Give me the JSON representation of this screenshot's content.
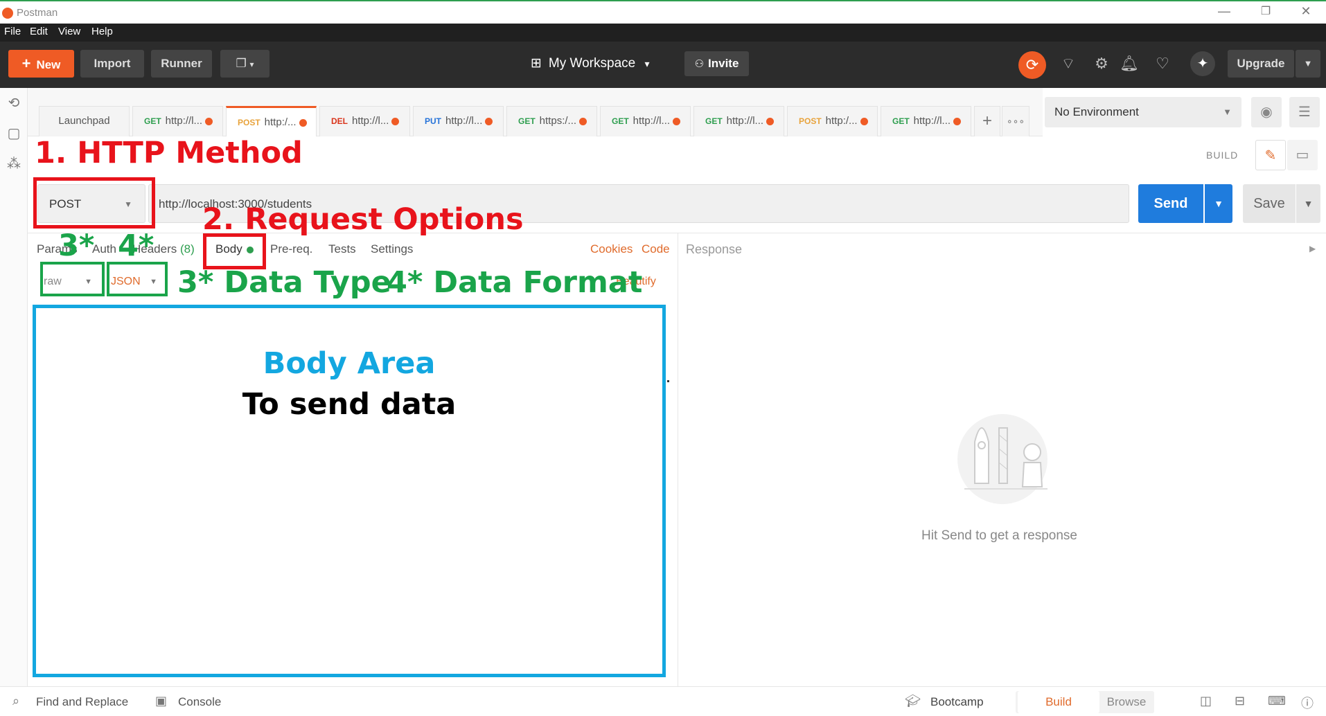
{
  "window": {
    "title": "Postman",
    "min": "—",
    "max": "❐",
    "close": "✕"
  },
  "menu": [
    "File",
    "Edit",
    "View",
    "Help"
  ],
  "header": {
    "new_label": "New",
    "import_label": "Import",
    "runner_label": "Runner",
    "workspace_label": "My Workspace",
    "invite_label": "Invite",
    "upgrade_label": "Upgrade"
  },
  "tabs": [
    {
      "label": "Launchpad",
      "method": "",
      "url": ""
    },
    {
      "label": "",
      "method": "GET",
      "url": "http://l..."
    },
    {
      "label": "",
      "method": "POST",
      "url": "http:/..."
    },
    {
      "label": "",
      "method": "DEL",
      "url": "http://l..."
    },
    {
      "label": "",
      "method": "PUT",
      "url": "http://l..."
    },
    {
      "label": "",
      "method": "GET",
      "url": "https:/..."
    },
    {
      "label": "",
      "method": "GET",
      "url": "http://l..."
    },
    {
      "label": "",
      "method": "GET",
      "url": "http://l..."
    },
    {
      "label": "",
      "method": "POST",
      "url": "http:/..."
    },
    {
      "label": "",
      "method": "GET",
      "url": "http://l..."
    }
  ],
  "environment": {
    "selected": "No Environment"
  },
  "mode_label": "BUILD",
  "request": {
    "method": "POST",
    "url": "http://localhost:3000/students",
    "send_label": "Send",
    "save_label": "Save"
  },
  "request_tabs": {
    "params": "Params",
    "auth": "Auth",
    "headers": "Headers",
    "headers_count": "(8)",
    "body": "Body",
    "prereq": "Pre-req.",
    "tests": "Tests",
    "settings": "Settings",
    "cookies": "Cookies",
    "code": "Code"
  },
  "body_options": {
    "data_type": "raw",
    "data_format": "JSON",
    "beautify": "Beautify"
  },
  "response": {
    "label": "Response",
    "empty_message": "Hit Send to get a response"
  },
  "annotations": {
    "http_method": "1. HTTP Method",
    "request_options": "2. Request Options",
    "marker3": "3*",
    "marker4": "4*",
    "data_type": "3* Data Type",
    "data_format": "4* Data Format",
    "body_area_title": "Body Area",
    "body_area_sub": "To send data"
  },
  "footer": {
    "find_replace": "Find and Replace",
    "console": "Console",
    "bootcamp": "Bootcamp",
    "build": "Build",
    "browse": "Browse"
  },
  "colors": {
    "accent": "#ef5b25",
    "send_blue": "#1f7cdd",
    "annotation_red": "#e8131b",
    "annotation_green": "#1aa44a",
    "annotation_blue": "#13a7e0"
  }
}
